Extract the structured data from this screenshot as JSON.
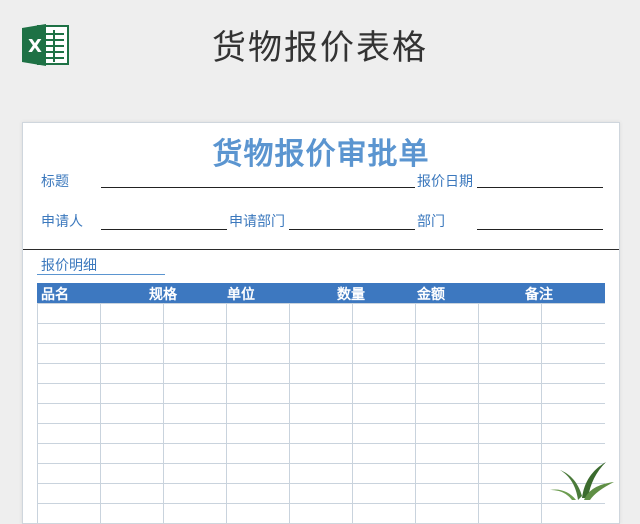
{
  "header": {
    "app_icon": "excel-icon",
    "title": "货物报价表格"
  },
  "form": {
    "title": "货物报价审批单",
    "fields": {
      "subject_label": "标题",
      "quote_date_label": "报价日期",
      "applicant_label": "申请人",
      "applying_dept_label": "申请部门",
      "dept_label": "部门"
    },
    "details": {
      "section_label": "报价明细",
      "columns": [
        "品名",
        "规格",
        "单位",
        "数量",
        "金额",
        "备注"
      ]
    }
  },
  "colors": {
    "accent": "#5b95d0",
    "header_fill": "#3d78c0",
    "excel_green": "#1e7145"
  },
  "decoration": {
    "plant_icon": "plant-icon"
  }
}
